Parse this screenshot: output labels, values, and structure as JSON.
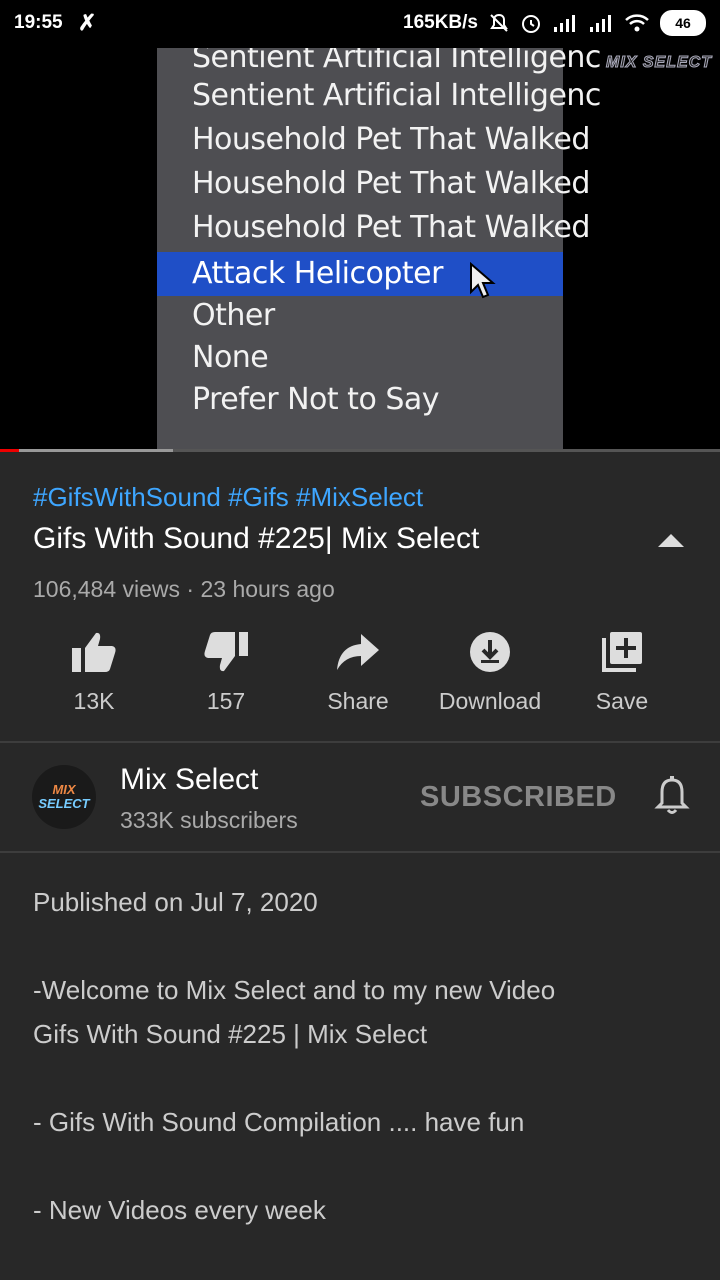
{
  "status_bar": {
    "time": "19:55",
    "network_speed": "165KB/s",
    "battery": "46",
    "icons": [
      "app-icon",
      "mute-icon",
      "alarm-icon",
      "signal-icon",
      "signal-icon",
      "wifi-icon",
      "battery-icon"
    ]
  },
  "video": {
    "watermark": "MIX SELECT",
    "menu_items": [
      "Sentient Artificial Intelligenc",
      "Sentient Artificial Intelligenc",
      "Household Pet That Walked",
      "Household Pet That Walked",
      "Household Pet That Walked",
      "Attack Helicopter",
      "Other",
      "None",
      "Prefer Not to Say"
    ],
    "selected_item": "Attack Helicopter",
    "progress_fraction": 0.026,
    "buffered_fraction": 0.24
  },
  "video_info": {
    "hashtags": "#GifsWithSound #Gifs #MixSelect",
    "title": "Gifs With Sound #225| Mix Select",
    "meta": "106,484 views · 23 hours ago"
  },
  "actions": [
    {
      "label": "13K",
      "icon": "thumbs-up-icon"
    },
    {
      "label": "157",
      "icon": "thumbs-down-icon"
    },
    {
      "label": "Share",
      "icon": "share-icon"
    },
    {
      "label": "Download",
      "icon": "download-icon"
    },
    {
      "label": "Save",
      "icon": "add-to-playlist-icon"
    }
  ],
  "channel": {
    "name": "Mix Select",
    "subscribers": "333K subscribers",
    "subscribe_state": "SUBSCRIBED",
    "avatar_line1": "MIX",
    "avatar_line2": "SELECT"
  },
  "description": {
    "published": "Published on Jul 7, 2020",
    "lines": [
      "-Welcome to Mix Select and to my new Video",
      "Gifs With Sound #225 | Mix Select",
      "- Gifs With Sound Compilation .... have fun",
      "- New Videos every week"
    ]
  },
  "colors": {
    "background": "#282828",
    "link": "#3ea6ff",
    "progress": "#ee0000",
    "selection": "#1f4fc7"
  }
}
